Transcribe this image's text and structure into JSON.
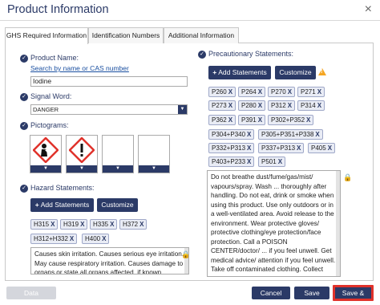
{
  "title": "Product Information",
  "close_icon": "×",
  "tabs": [
    {
      "label": "GHS Required Information"
    },
    {
      "label": "Identification Numbers"
    },
    {
      "label": "Additional Information"
    }
  ],
  "product": {
    "label": "Product Name:",
    "link": "Search by name or CAS number",
    "value": "Iodine"
  },
  "signal": {
    "label": "Signal Word:",
    "value": "DANGER"
  },
  "pictograms": {
    "label": "Pictograms:",
    "icons": [
      "health-hazard-pictogram",
      "exclamation-mark-pictogram",
      "empty-pictogram",
      "empty-pictogram"
    ]
  },
  "hazard": {
    "label": "Hazard Statements:",
    "add_label": "Add Statements",
    "customize_label": "Customize",
    "tags": [
      "H315",
      "H319",
      "H335",
      "H372",
      "H312+H332",
      "H400"
    ],
    "text": "Causes skin irritation. Causes serious eye irritation. May cause respiratory irritation. Causes damage to organs or state all organs affected, if known"
  },
  "precautionary": {
    "label": "Precautionary Statements:",
    "add_label": "Add Statements",
    "customize_label": "Customize",
    "tags": [
      "P260",
      "P264",
      "P270",
      "P271",
      "P273",
      "P280",
      "P312",
      "P314",
      "P362",
      "P391",
      "P302+P352",
      "P304+P340",
      "P305+P351+P338",
      "P332+P313",
      "P337+P313",
      "P405",
      "P403+P233",
      "P501"
    ],
    "text": "Do not breathe dust/fume/gas/mist/ vapours/spray. Wash ... thoroughly after handling. Do not eat, drink or smoke when using this product. Use only outdoors or in a well-ventilated area. Avoid release to the environment. Wear protective gloves/ protective clothing/eye protection/face protection. Call a POISON CENTER/doctor/ ... if you feel unwell. Get medical advice/ attention if you feel unwell. Take off contaminated clothing. Collect spillage. IF ON SKIN: Wash with plenty of water/..."
  },
  "tag_remove": "X",
  "footer": {
    "data_translations": "Data Translations",
    "cancel": "Cancel",
    "save": "Save",
    "save_close": "Save & Close"
  },
  "colors": {
    "primary": "#2b3a67",
    "highlight": "#e0322b",
    "warning": "#f5a623"
  }
}
